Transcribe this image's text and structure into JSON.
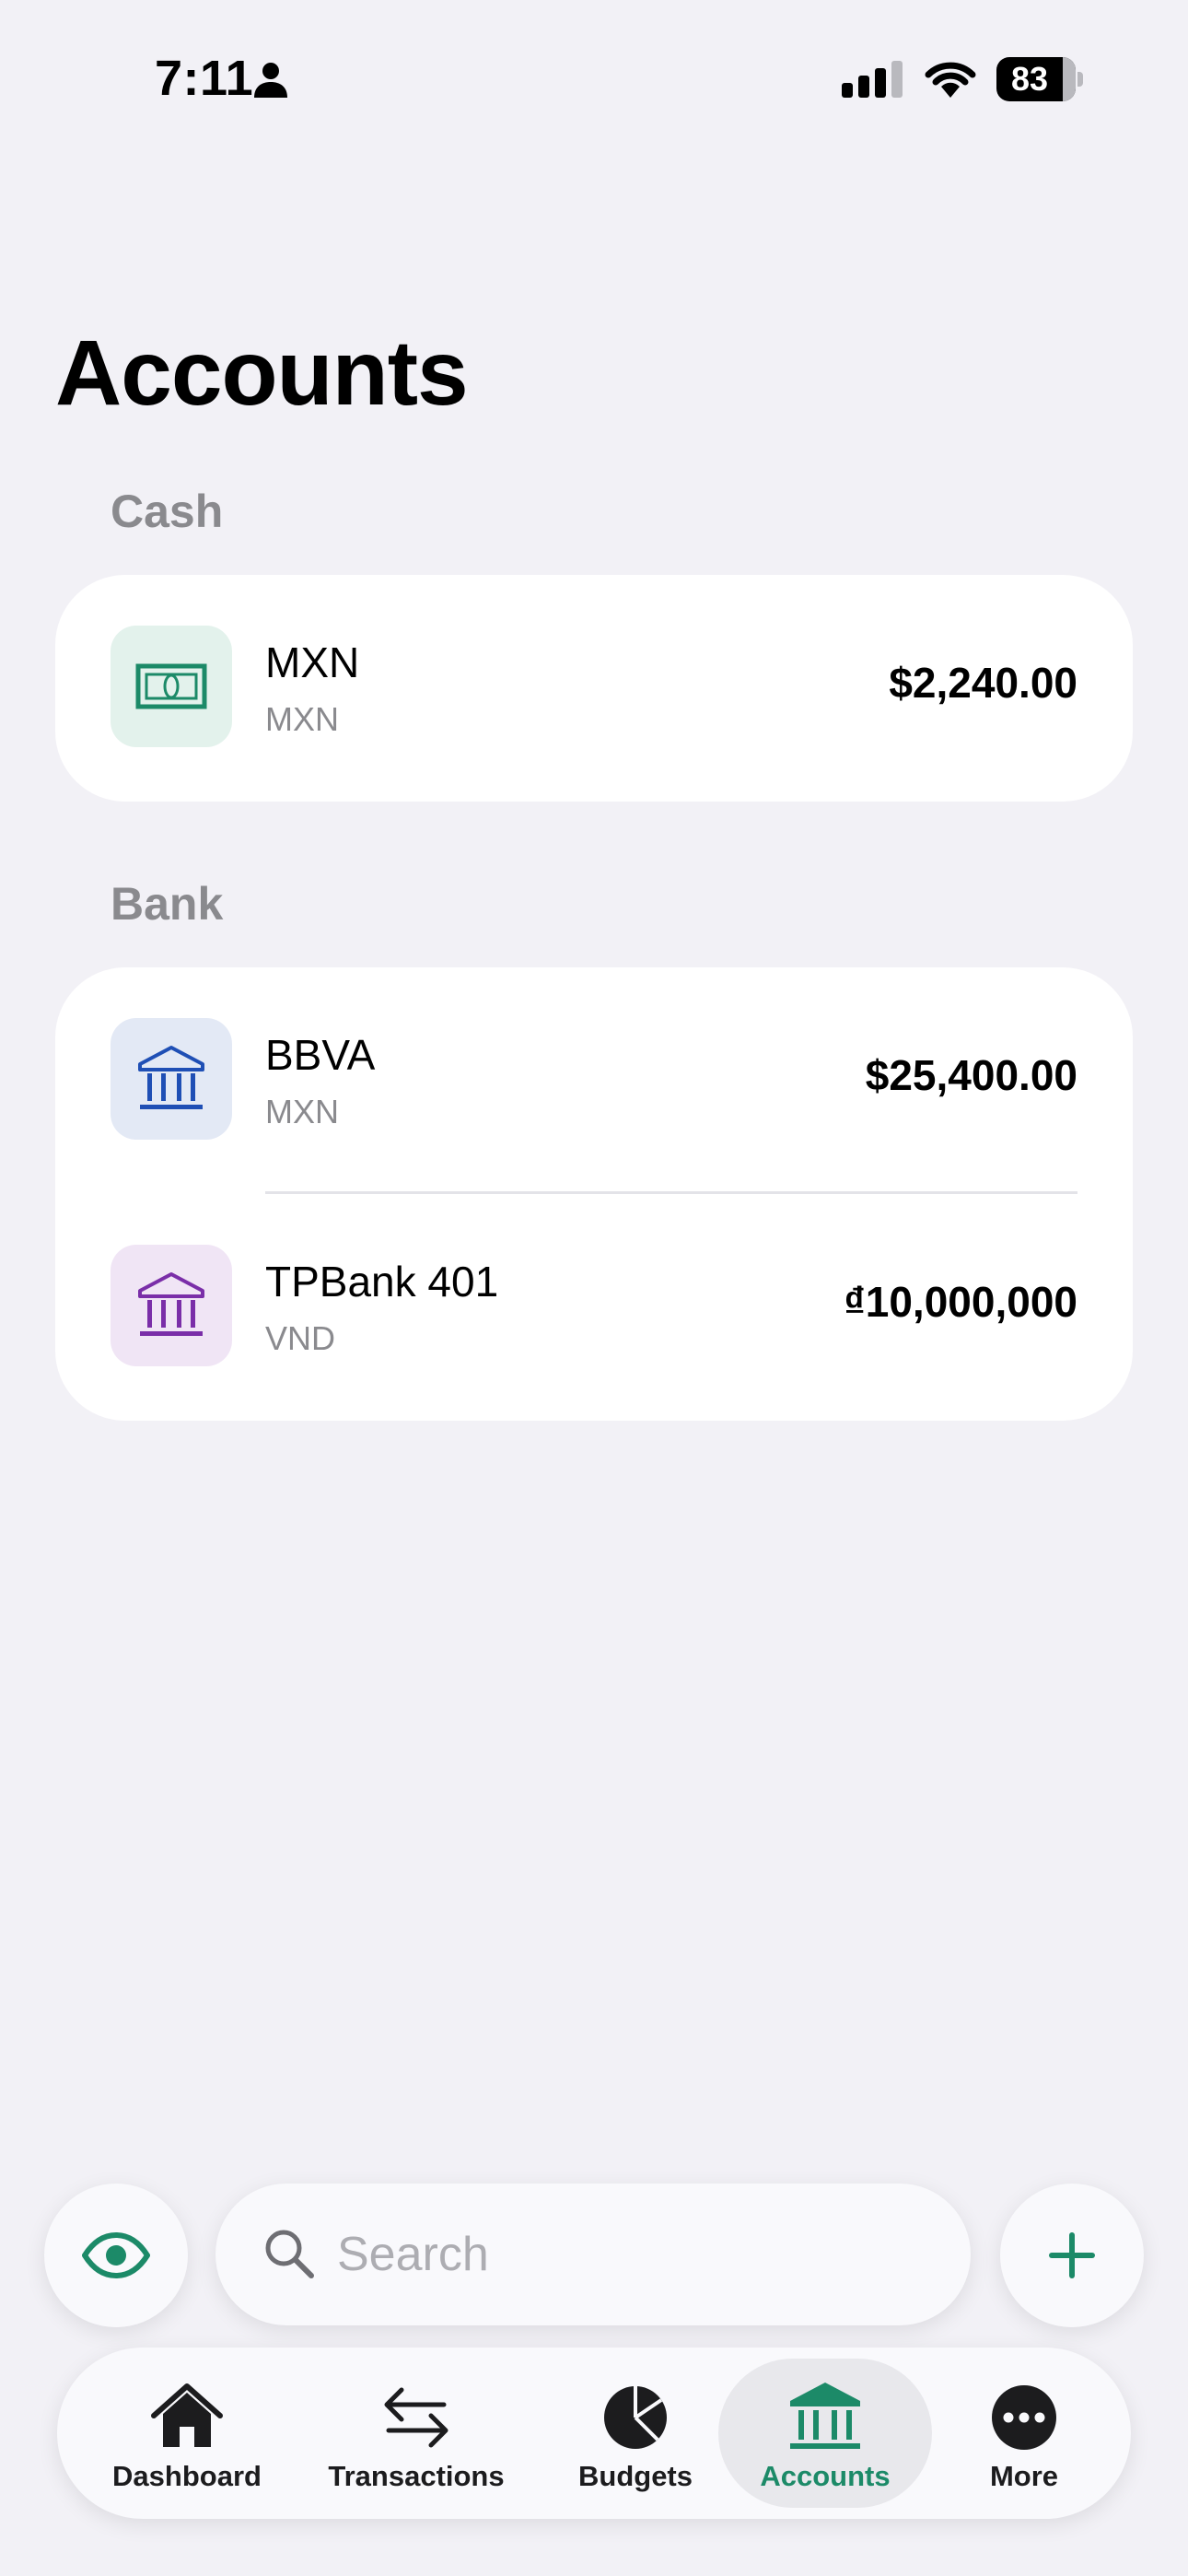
{
  "status_bar": {
    "time": "7:11",
    "battery": "83"
  },
  "page": {
    "title": "Accounts"
  },
  "sections": {
    "cash": {
      "header": "Cash",
      "accounts": [
        {
          "name": "MXN",
          "currency": "MXN",
          "amount": "$2,240.00",
          "icon": "banknote-icon",
          "color": "#1C8A68",
          "tint": "#E3F2EC"
        }
      ]
    },
    "bank": {
      "header": "Bank",
      "accounts": [
        {
          "name": "BBVA",
          "currency": "MXN",
          "amount": "$25,400.00",
          "icon": "bank-icon",
          "color": "#1F4FB5",
          "tint": "#E3E9F5"
        },
        {
          "name": "TPBank 401",
          "currency": "VND",
          "amount": "₫10,000,000",
          "icon": "bank-icon",
          "color": "#7A2EA8",
          "tint": "#F0E5F5"
        }
      ]
    }
  },
  "search": {
    "placeholder": "Search"
  },
  "tabs": [
    {
      "label": "Dashboard",
      "icon": "house-icon",
      "active": false
    },
    {
      "label": "Transactions",
      "icon": "arrows-left-right-icon",
      "active": false
    },
    {
      "label": "Budgets",
      "icon": "pie-chart-icon",
      "active": false
    },
    {
      "label": "Accounts",
      "icon": "bank-icon",
      "active": true
    },
    {
      "label": "More",
      "icon": "ellipsis-circle-icon",
      "active": false
    }
  ],
  "colors": {
    "accent": "#1C8A68",
    "background": "#F2F1F6",
    "secondary_text": "#8A8A8E"
  }
}
